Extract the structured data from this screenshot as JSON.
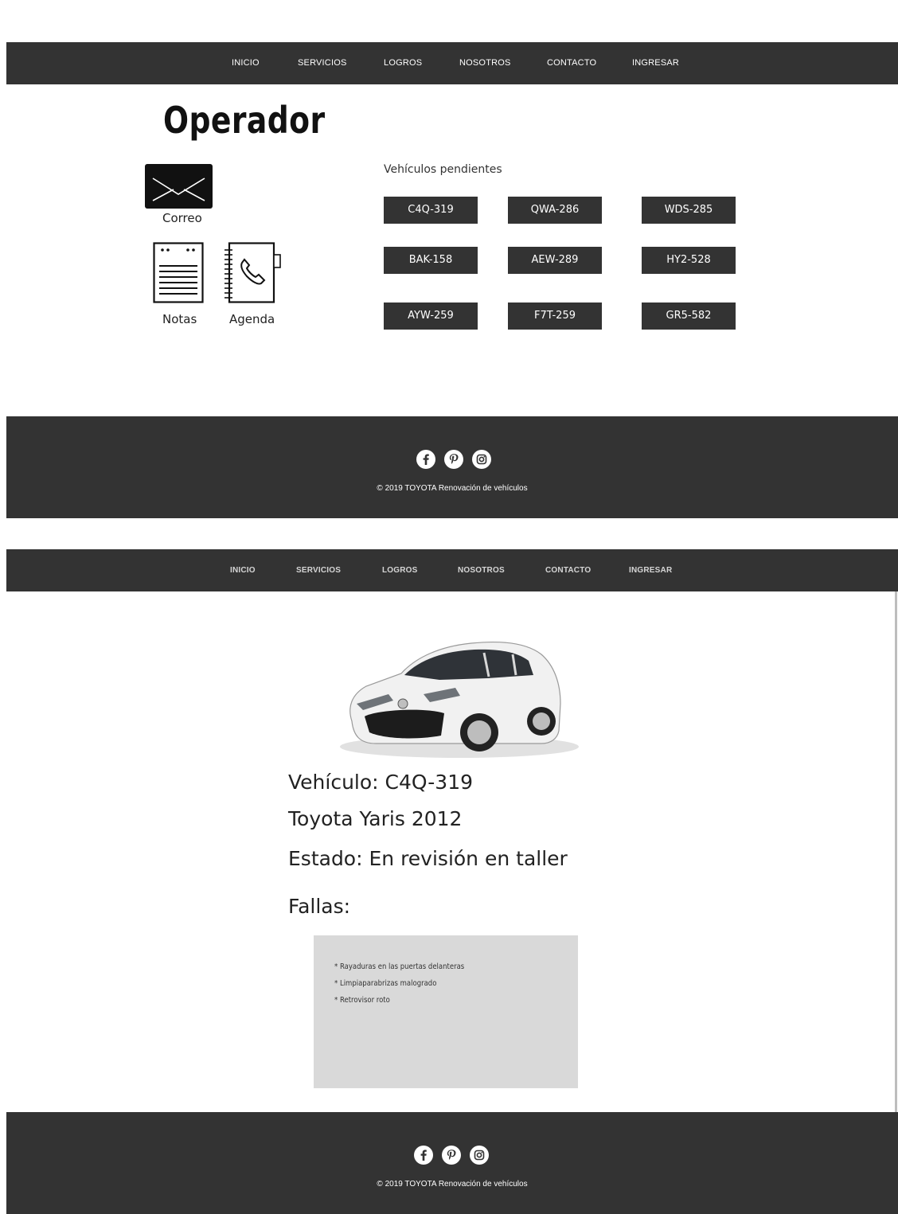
{
  "nav": {
    "items": [
      "INICIO",
      "SERVICIOS",
      "LOGROS",
      "NOSOTROS",
      "CONTACTO",
      "INGRESAR"
    ]
  },
  "operator_page": {
    "title": "Operador",
    "tools": {
      "mail_label": "Correo",
      "notes_label": "Notas",
      "agenda_label": "Agenda"
    },
    "pending_label": "Vehículos pendientes",
    "plates": [
      "C4Q-319",
      "QWA-286",
      "WDS-285",
      "BAK-158",
      "AEW-289",
      "HY2-528",
      "AYW-259",
      "F7T-259",
      "GR5-582"
    ]
  },
  "footer": {
    "social": [
      "facebook-icon",
      "pinterest-icon",
      "instagram-icon"
    ],
    "copyright": "© 2019 TOYOTA Renovación de vehículos"
  },
  "vehicle_page": {
    "vehicle": "Vehículo: C4Q-319",
    "model": "Toyota Yaris 2012",
    "status": "Estado: En revisión en taller",
    "faults_label": "Fallas:",
    "faults": [
      "* Rayaduras en las puertas delanteras",
      "* Limpiaparabrizas malogrado",
      "* Retrovisor roto"
    ]
  },
  "colors": {
    "nav_bg": "#333333",
    "plate_bg": "#333333",
    "faults_bg": "#d9d9d9"
  }
}
